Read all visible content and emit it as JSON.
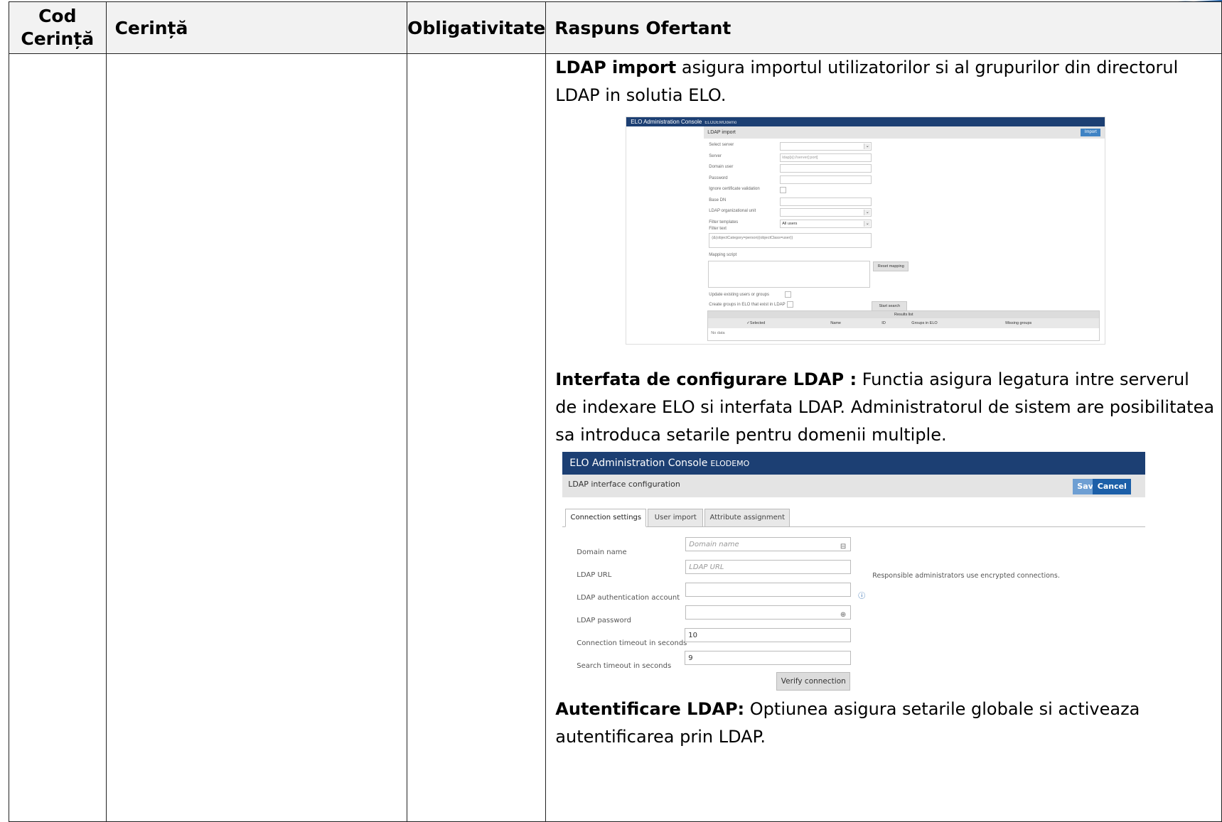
{
  "table": {
    "headers": {
      "cod": "Cod\nCerință",
      "cerinta": "Cerință",
      "obligativitate": "Obligativitate",
      "raspuns": "Raspuns Ofertant"
    },
    "response": {
      "p1_bold": "LDAP import",
      "p1_text": " asigura importul utilizatorilor si al grupurilor din directorul LDAP in solutia ELO.",
      "p2_bold": "Interfata de configurare LDAP :",
      "p2_text": " Functia asigura legatura intre serverul de indexare ELO si interfata LDAP. Administratorul de sistem are posibilitatea sa introduca setarile pentru domenii multiple.",
      "p3_bold": "Autentificare LDAP:",
      "p3_text": " Optiunea asigura setarile globale si activeaza autentificarea prin LDAP."
    }
  },
  "shot1": {
    "app_title": "ELO Administration Console",
    "app_sub": "ELODEMOdemo",
    "page_title": "LDAP import",
    "import_btn": "Import",
    "fields": {
      "select_server": "Select server",
      "server": "Server",
      "server_ph": "ldap[s]://server[:port]",
      "domain_user": "Domain user",
      "password": "Password",
      "ignore_cert": "Ignore certificate validation",
      "base_dn": "Base DN",
      "ldap_ou": "LDAP organizational unit",
      "filter_templates": "Filter templates",
      "filter_templates_val": "All users",
      "filter_text": "Filter text",
      "filter_text_val": "(&(objectCategory=person)(objectClass=user))",
      "mapping_script": "Mapping script",
      "reset_mapping": "Reset mapping",
      "update_existing": "Update existing users or groups",
      "create_groups": "Create groups in ELO that exist in LDAP",
      "start_search": "Start search"
    },
    "results": {
      "title": "Results list",
      "col_selected": "Selected",
      "col_name": "Name",
      "col_id": "ID",
      "col_groups": "Groups in ELO",
      "col_missing": "Missing groups",
      "no_data": "No data"
    }
  },
  "shot2": {
    "app_title": "ELO Administration Console",
    "app_sub": "ELODEMO",
    "page_title": "LDAP interface configuration",
    "save": "Save",
    "cancel": "Cancel",
    "tabs": [
      "Connection settings",
      "User import",
      "Attribute assignment"
    ],
    "fields": {
      "domain_name": "Domain name",
      "domain_name_ph": "Domain name",
      "ldap_url": "LDAP URL",
      "ldap_url_ph": "LDAP URL",
      "ldap_url_note": "Responsible administrators use encrypted connections.",
      "auth_account": "LDAP authentication account",
      "password": "LDAP password",
      "conn_timeout": "Connection timeout in seconds",
      "conn_timeout_val": "10",
      "search_timeout": "Search timeout in seconds",
      "search_timeout_val": "9"
    },
    "verify": "Verify connection"
  },
  "colors": {
    "header_bg": "#f2f2f2",
    "console_bar": "#1c3f73",
    "cancel_btn": "#1c5fa8",
    "save_btn": "#6e9fd3"
  }
}
